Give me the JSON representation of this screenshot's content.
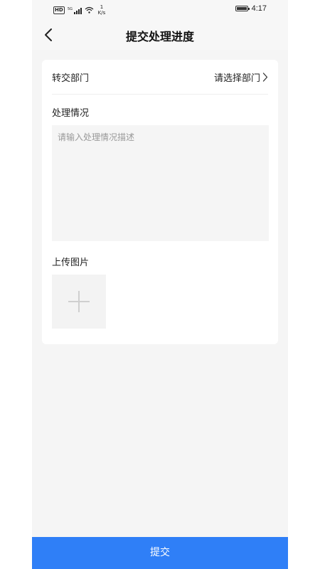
{
  "status_bar": {
    "hd_badge": "HD",
    "network_type": "5G",
    "speed_value": "1",
    "speed_unit": "K/s",
    "time": "4:17",
    "icons": [
      "signal-icon",
      "wifi-icon",
      "battery-icon"
    ]
  },
  "nav": {
    "title": "提交处理进度",
    "back_icon": "chevron-left-icon"
  },
  "form": {
    "department": {
      "label": "转交部门",
      "placeholder": "请选择部门",
      "icon": "chevron-right-icon"
    },
    "description": {
      "label": "处理情况",
      "placeholder": "请输入处理情况描述",
      "value": ""
    },
    "upload": {
      "label": "上传图片",
      "icon": "plus-icon"
    }
  },
  "submit": {
    "label": "提交",
    "color": "#2f7ff7"
  }
}
